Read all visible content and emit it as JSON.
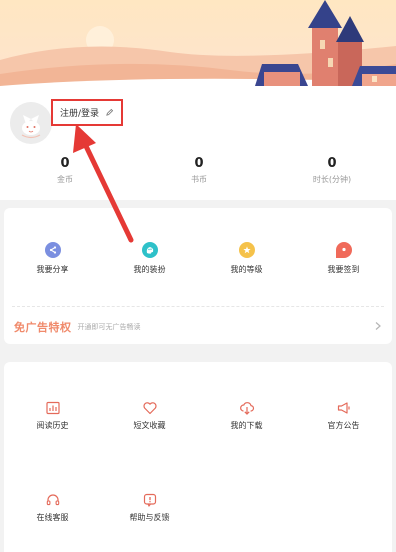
{
  "profile": {
    "login_label": "注册/登录"
  },
  "stats": [
    {
      "value": "0",
      "label": "金币"
    },
    {
      "value": "0",
      "label": "书币"
    },
    {
      "value": "0",
      "label": "时长(分钟)"
    }
  ],
  "quick_actions": [
    {
      "label": "我要分享",
      "icon": "share-icon"
    },
    {
      "label": "我的装扮",
      "icon": "dress-up-icon"
    },
    {
      "label": "我的等级",
      "icon": "level-icon"
    },
    {
      "label": "我要签到",
      "icon": "sign-in-icon"
    }
  ],
  "ad_banner": {
    "title": "免广告特权",
    "subtitle": "开通即可无广告畅读"
  },
  "tools": [
    {
      "label": "阅读历史",
      "icon": "history-icon"
    },
    {
      "label": "短文收藏",
      "icon": "heart-icon"
    },
    {
      "label": "我的下载",
      "icon": "download-icon"
    },
    {
      "label": "官方公告",
      "icon": "megaphone-icon"
    },
    {
      "label": "在线客服",
      "icon": "headset-icon"
    },
    {
      "label": "帮助与反馈",
      "icon": "help-icon"
    }
  ],
  "colors": {
    "annotation_red": "#e53935",
    "accent_orange": "#f08a6b",
    "icon_red": "#e46a5a"
  }
}
